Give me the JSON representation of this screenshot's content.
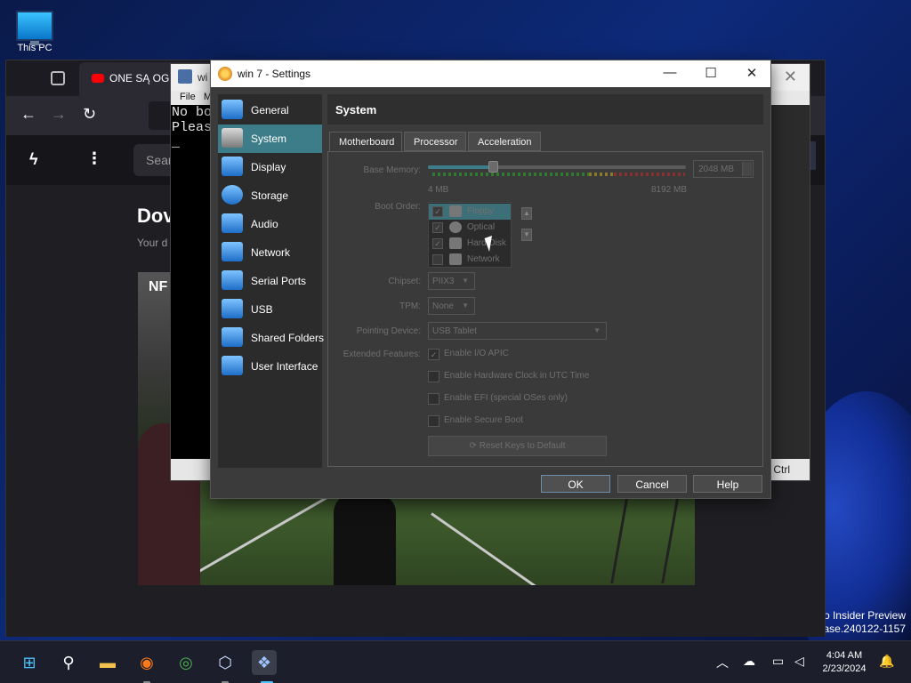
{
  "desktop": {
    "icon_label": "This PC",
    "watermark_line1": "ro Insider Preview",
    "watermark_line2": "lease.240122-1157"
  },
  "browser": {
    "tab_title": "ONE SĄ OGRO",
    "search_placeholder": "Sear",
    "page_heading": "Dov",
    "page_sub": "Your d",
    "video_label": "NF"
  },
  "vm_window": {
    "title": "wi",
    "menu_file": "File",
    "menu_m": "M",
    "screen_line1": "No bo",
    "screen_line2": "Pleas",
    "screen_cursor": "_",
    "status_ctrl": "Ctrl"
  },
  "dialog": {
    "title": "win 7 - Settings",
    "section_title": "System",
    "sidebar": [
      {
        "label": "General",
        "icon": "monitor-icon"
      },
      {
        "label": "System",
        "icon": "system-board-icon"
      },
      {
        "label": "Display",
        "icon": "display-icon"
      },
      {
        "label": "Storage",
        "icon": "storage-disk-icon"
      },
      {
        "label": "Audio",
        "icon": "speaker-icon"
      },
      {
        "label": "Network",
        "icon": "network-icon"
      },
      {
        "label": "Serial Ports",
        "icon": "serial-port-icon"
      },
      {
        "label": "USB",
        "icon": "usb-icon"
      },
      {
        "label": "Shared Folders",
        "icon": "folder-icon"
      },
      {
        "label": "User Interface",
        "icon": "window-icon"
      }
    ],
    "active_sidebar": "System",
    "tabs": [
      {
        "label": "Motherboard"
      },
      {
        "label": "Processor"
      },
      {
        "label": "Acceleration"
      }
    ],
    "active_tab": "Motherboard",
    "base_memory": {
      "label": "Base Memory:",
      "value": "2048 MB",
      "min_label": "4 MB",
      "max_label": "8192 MB",
      "fraction": 0.25
    },
    "boot_order": {
      "label": "Boot Order:",
      "items": [
        {
          "label": "Floppy",
          "checked": true,
          "icon": "floppy-icon"
        },
        {
          "label": "Optical",
          "checked": true,
          "icon": "optical-disc-icon"
        },
        {
          "label": "Hard Disk",
          "checked": true,
          "icon": "hard-disk-icon"
        },
        {
          "label": "Network",
          "checked": false,
          "icon": "network-icon"
        }
      ]
    },
    "chipset": {
      "label": "Chipset:",
      "value": "PIIX3"
    },
    "tpm": {
      "label": "TPM:",
      "value": "None"
    },
    "pointing_device": {
      "label": "Pointing Device:",
      "value": "USB Tablet"
    },
    "extended_features": {
      "label": "Extended Features:",
      "items": [
        {
          "label": "Enable I/O APIC",
          "checked": true
        },
        {
          "label": "Enable Hardware Clock in UTC Time",
          "checked": false
        },
        {
          "label": "Enable EFI (special OSes only)",
          "checked": false
        },
        {
          "label": "Enable Secure Boot",
          "checked": false
        }
      ]
    },
    "reset_keys_label": "Reset Keys to Default",
    "ok_label": "OK",
    "cancel_label": "Cancel",
    "help_label": "Help"
  },
  "taskbar": {
    "time": "4:04 AM",
    "date": "2/23/2024"
  }
}
